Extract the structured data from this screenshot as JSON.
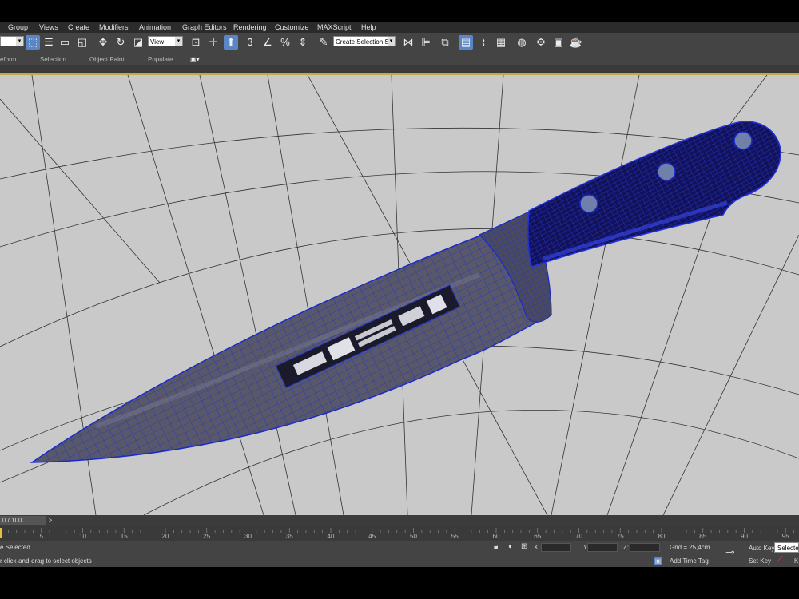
{
  "menu": [
    "Group",
    "Views",
    "Create",
    "Modifiers",
    "Animation",
    "Graph Editors",
    "Rendering",
    "Customize",
    "MAXScript",
    "Help"
  ],
  "toolbar": {
    "view_dropdown": "View",
    "selection_set_dropdown": "Create Selection Se",
    "snap_label": "3",
    "percent_label": "%"
  },
  "ribbon": [
    "eform",
    "Selection",
    "Object Paint",
    "Populate"
  ],
  "trackbar": {
    "frame": "0 / 100",
    "next": ">"
  },
  "timeline": {
    "ticks": [
      5,
      10,
      15,
      20,
      25,
      30,
      35,
      40,
      45,
      50,
      55,
      60,
      65,
      70,
      75,
      80,
      85,
      90,
      95
    ]
  },
  "status": {
    "selection": "e Selected",
    "prompt": "r click-and-drag to select objects",
    "x_label": "X:",
    "y_label": "Y:",
    "z_label": "Z:",
    "grid": "Grid = 25,4cm",
    "add_time_tag": "Add Time Tag",
    "auto_key": "Auto Key",
    "selected": "Selected",
    "set_key": "Set Key",
    "k_label": "K"
  },
  "colors": {
    "menubar": "#2b2b2b",
    "toolbar": "#444444",
    "viewport": "#c8c8c8",
    "handle": "#1a1a6e",
    "blade": "#555566",
    "wire": "#1a2acc",
    "active_button": "#5b86c5",
    "gold_border": "#c8a64a"
  }
}
